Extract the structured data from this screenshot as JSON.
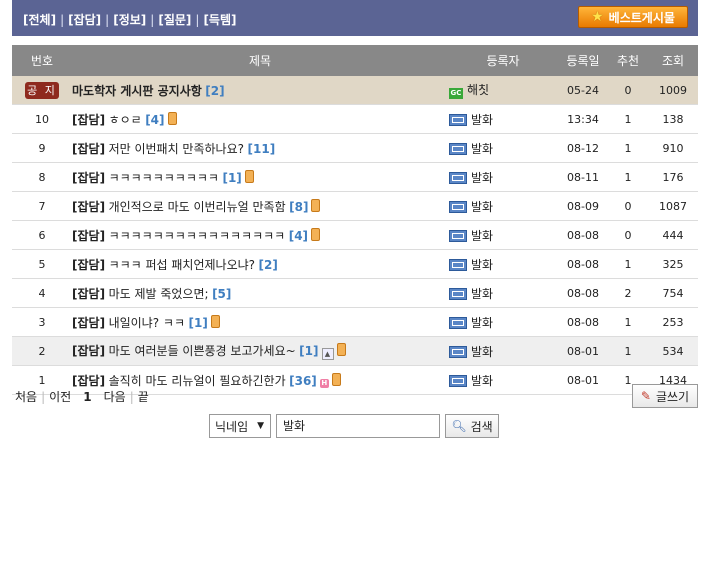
{
  "categories": [
    "[전체]",
    "[잡담]",
    "[정보]",
    "[질문]",
    "[득템]"
  ],
  "separator": "|",
  "best_button": "베스트게시물",
  "columns": {
    "no": "번호",
    "title": "제목",
    "author": "등록자",
    "date": "등록일",
    "rec": "추천",
    "views": "조회"
  },
  "rows": [
    {
      "no": "공 지",
      "cat": "",
      "title": "마도학자 게시판 공지사항",
      "comments": "[2]",
      "author": "해칫",
      "date": "05-24",
      "rec": "0",
      "views": "1009"
    },
    {
      "no": "10",
      "cat": "[잡담]",
      "title": "ㅎㅇㄹ",
      "comments": "[4]",
      "author": "발화",
      "date": "13:34",
      "rec": "1",
      "views": "138"
    },
    {
      "no": "9",
      "cat": "[잡담]",
      "title": "저만 이번패치 만족하나요?",
      "comments": "[11]",
      "author": "발화",
      "date": "08-12",
      "rec": "1",
      "views": "910"
    },
    {
      "no": "8",
      "cat": "[잡담]",
      "title": "ㅋㅋㅋㅋㅋㅋㅋㅋㅋㅋ",
      "comments": "[1]",
      "author": "발화",
      "date": "08-11",
      "rec": "1",
      "views": "176"
    },
    {
      "no": "7",
      "cat": "[잡담]",
      "title": "개인적으로 마도 이번리뉴얼 만족함",
      "comments": "[8]",
      "author": "발화",
      "date": "08-09",
      "rec": "0",
      "views": "1087"
    },
    {
      "no": "6",
      "cat": "[잡담]",
      "title": "ㅋㅋㅋㅋㅋㅋㅋㅋㅋㅋㅋㅋㅋㅋㅋㅋ",
      "comments": "[4]",
      "author": "발화",
      "date": "08-08",
      "rec": "0",
      "views": "444"
    },
    {
      "no": "5",
      "cat": "[잡담]",
      "title": "ㅋㅋㅋ 퍼섭 패치언제나오냐?",
      "comments": "[2]",
      "author": "발화",
      "date": "08-08",
      "rec": "1",
      "views": "325"
    },
    {
      "no": "4",
      "cat": "[잡담]",
      "title": "마도 제발 죽었으면;",
      "comments": "[5]",
      "author": "발화",
      "date": "08-08",
      "rec": "2",
      "views": "754"
    },
    {
      "no": "3",
      "cat": "[잡담]",
      "title": "내일이냐? ㅋㅋ",
      "comments": "[1]",
      "author": "발화",
      "date": "08-08",
      "rec": "1",
      "views": "253"
    },
    {
      "no": "2",
      "cat": "[잡담]",
      "title": "마도 여러분들 이쁜풍경 보고가세요~",
      "comments": "[1]",
      "author": "발화",
      "date": "08-01",
      "rec": "1",
      "views": "534"
    },
    {
      "no": "1",
      "cat": "[잡담]",
      "title": "솔직히 마도 리뉴얼이 필요하긴한가",
      "comments": "[36]",
      "author": "발화",
      "date": "08-01",
      "rec": "1",
      "views": "1434"
    }
  ],
  "pager": {
    "first": "처음",
    "prev": "이전",
    "current": "1",
    "next": "다음",
    "last": "끝"
  },
  "write_button": "글쓰기",
  "search": {
    "field": "닉네임",
    "value": "발화",
    "button": "검색"
  },
  "colors": {
    "header_bar": "#5b6494",
    "notice_row": "#e0d7c6",
    "table_header": "#888888",
    "comment_count": "#3f7ec0",
    "best_button": "#f08c0c"
  }
}
